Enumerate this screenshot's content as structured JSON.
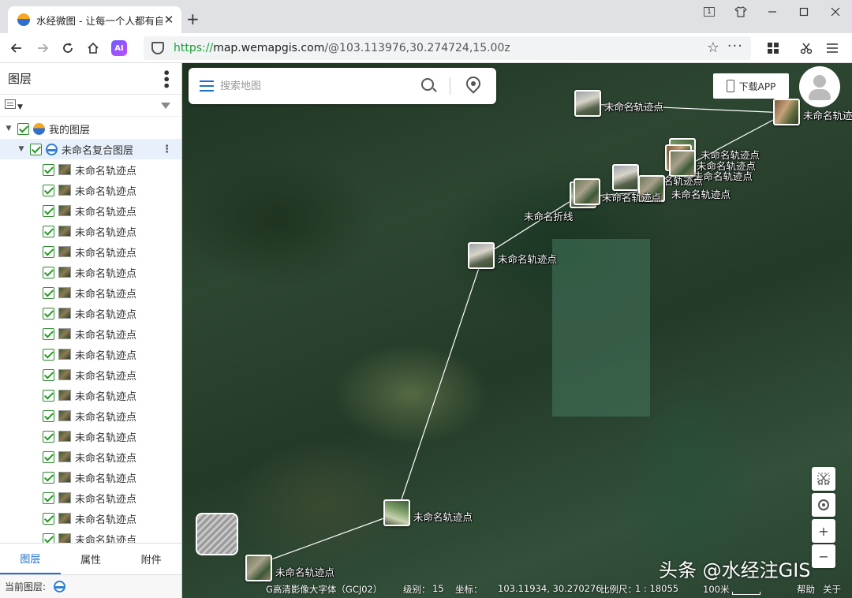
{
  "browser": {
    "tab_title": "水经微图 - 让每一个人都有自",
    "close_glyph": "✕",
    "new_tab_glyph": "+",
    "url_protocol": "https://",
    "url_host": "map.wemapgis.com",
    "url_path": "/@103.113976,30.274724,15.00z",
    "ai_label": "AI",
    "window_badge": "1"
  },
  "panel": {
    "title": "图层",
    "root_layer": "我的图层",
    "composite_layer": "未命名复合图层",
    "track_points": [
      "未命名轨迹点",
      "未命名轨迹点",
      "未命名轨迹点",
      "未命名轨迹点",
      "未命名轨迹点",
      "未命名轨迹点",
      "未命名轨迹点",
      "未命名轨迹点",
      "未命名轨迹点",
      "未命名轨迹点",
      "未命名轨迹点",
      "未命名轨迹点",
      "未命名轨迹点",
      "未命名轨迹点",
      "未命名轨迹点",
      "未命名轨迹点",
      "未命名轨迹点",
      "未命名轨迹点",
      "未命名轨迹点"
    ],
    "tabs": [
      "图层",
      "属性",
      "附件"
    ],
    "current_layer_label": "当前图层:"
  },
  "map": {
    "search_placeholder": "搜索地图",
    "download_app": "下载APP",
    "markers": {
      "m1": "未命名轨迹点",
      "m2": "未命名轨迹点",
      "m3": "未命名轨迹点",
      "m4": "未命名轨迹点",
      "m5": "未命名轨迹点",
      "m6": "未命名轨迹点",
      "m7": "未命名轨迹点",
      "m8": "未命名轨迹点",
      "m9": "未命名轨迹点",
      "m10": "未命名轨迹点",
      "m11": "未命名轨迹点",
      "m12": "未命名轨迹点"
    },
    "polyline_label": "未命名折线",
    "zoom_in": "+",
    "zoom_out": "−",
    "status": {
      "basemap": "G高清影像大字体（GCJ02）",
      "level_label": "级别：",
      "level": "15",
      "coord_label": "坐标：",
      "coords": "103.11934, 30.270276",
      "scale_label": "比例尺：",
      "scale": "1 : 18055",
      "scale_bar": "100米",
      "help": "帮助",
      "close": "关于"
    },
    "watermark": "头条 @水经注GIS"
  }
}
